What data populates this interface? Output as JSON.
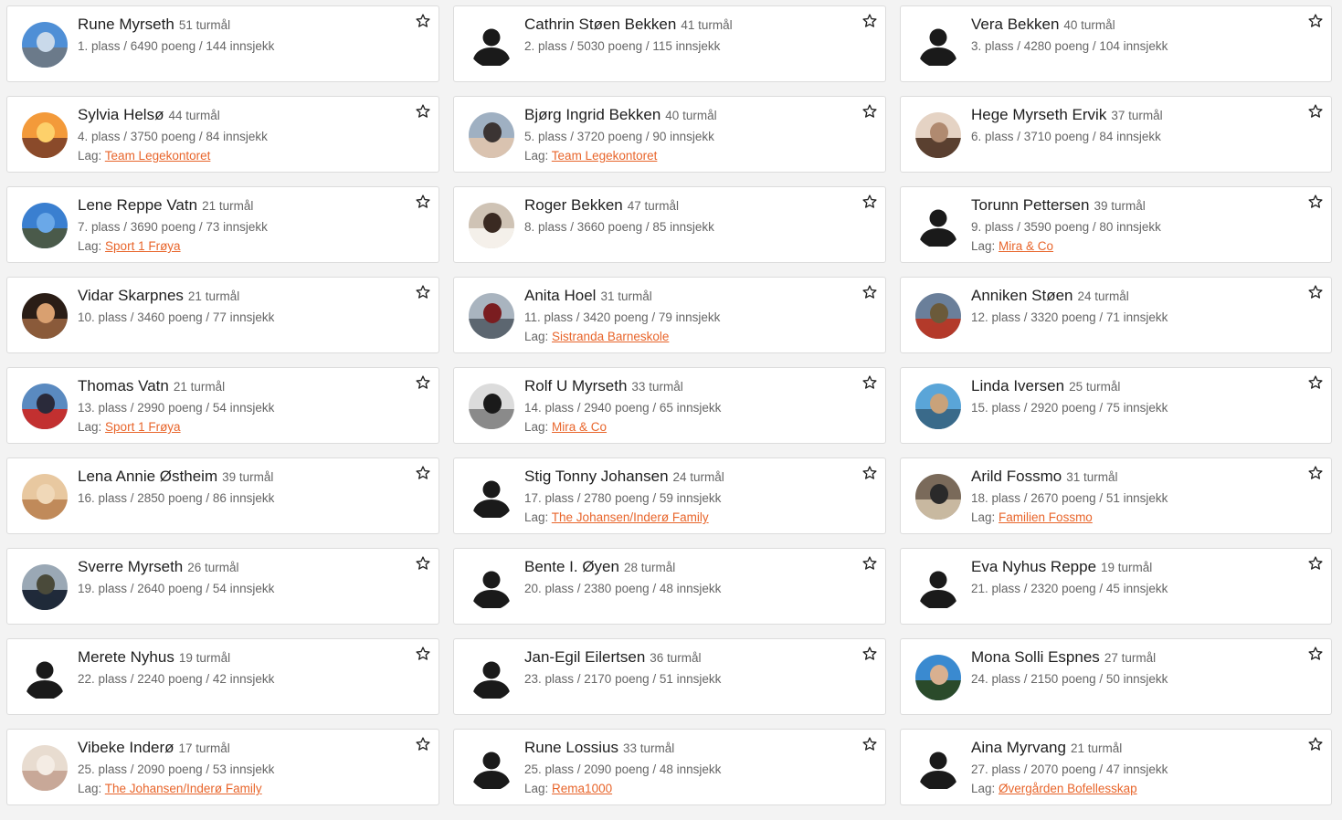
{
  "users": [
    {
      "name": "Rune Myrseth",
      "trips": "51 turmål",
      "stats": "1. plass / 6490 poeng / 144 innsjekk",
      "team": "",
      "avatar": "photo",
      "colors": [
        "#4f8fd6",
        "#c9d9ea",
        "#6b7a8a"
      ]
    },
    {
      "name": "Cathrin Støen Bekken",
      "trips": "41 turmål",
      "stats": "2. plass / 5030 poeng / 115 innsjekk",
      "team": "",
      "avatar": "default",
      "colors": []
    },
    {
      "name": "Vera Bekken",
      "trips": "40 turmål",
      "stats": "3. plass / 4280 poeng / 104 innsjekk",
      "team": "",
      "avatar": "default",
      "colors": []
    },
    {
      "name": "Sylvia Helsø",
      "trips": "44 turmål",
      "stats": "4. plass / 3750 poeng / 84 innsjekk",
      "team": "Team Legekontoret",
      "avatar": "photo",
      "colors": [
        "#f39a3a",
        "#fdd06a",
        "#8a4a2a"
      ]
    },
    {
      "name": "Bjørg Ingrid Bekken",
      "trips": "40 turmål",
      "stats": "5. plass / 3720 poeng / 90 innsjekk",
      "team": "Team Legekontoret",
      "avatar": "photo",
      "colors": [
        "#9fb0c2",
        "#3b3433",
        "#d9c3b0"
      ]
    },
    {
      "name": "Hege Myrseth Ervik",
      "trips": "37 turmål",
      "stats": "6. plass / 3710 poeng / 84 innsjekk",
      "team": "",
      "avatar": "photo",
      "colors": [
        "#e5d3c4",
        "#b08a70",
        "#5a4030"
      ]
    },
    {
      "name": "Lene Reppe Vatn",
      "trips": "21 turmål",
      "stats": "7. plass / 3690 poeng / 73 innsjekk",
      "team": "Sport 1 Frøya",
      "avatar": "photo",
      "colors": [
        "#3a7fd0",
        "#6aa8e8",
        "#4a5a4a"
      ]
    },
    {
      "name": "Roger Bekken",
      "trips": "47 turmål",
      "stats": "8. plass / 3660 poeng / 85 innsjekk",
      "team": "",
      "avatar": "photo",
      "colors": [
        "#cfc3b5",
        "#3a2a22",
        "#f4f0ea"
      ]
    },
    {
      "name": "Torunn Pettersen",
      "trips": "39 turmål",
      "stats": "9. plass / 3590 poeng / 80 innsjekk",
      "team": "Mira & Co",
      "avatar": "default",
      "colors": []
    },
    {
      "name": "Vidar Skarpnes",
      "trips": "21 turmål",
      "stats": "10. plass / 3460 poeng / 77 innsjekk",
      "team": "",
      "avatar": "photo",
      "colors": [
        "#2a1d16",
        "#d9a070",
        "#8a5a3a"
      ]
    },
    {
      "name": "Anita Hoel",
      "trips": "31 turmål",
      "stats": "11. plass / 3420 poeng / 79 innsjekk",
      "team": "Sistranda Barneskole",
      "avatar": "photo",
      "colors": [
        "#a9b4bf",
        "#7a1d20",
        "#5c6670"
      ]
    },
    {
      "name": "Anniken Støen",
      "trips": "24 turmål",
      "stats": "12. plass / 3320 poeng / 71 innsjekk",
      "team": "",
      "avatar": "photo",
      "colors": [
        "#6a7f9a",
        "#6b5a3a",
        "#b33a2a"
      ]
    },
    {
      "name": "Thomas Vatn",
      "trips": "21 turmål",
      "stats": "13. plass / 2990 poeng / 54 innsjekk",
      "team": "Sport 1 Frøya",
      "avatar": "photo",
      "colors": [
        "#5a8ac0",
        "#2a2a3a",
        "#c23030"
      ]
    },
    {
      "name": "Rolf U Myrseth",
      "trips": "33 turmål",
      "stats": "14. plass / 2940 poeng / 65 innsjekk",
      "team": "Mira & Co",
      "avatar": "photo",
      "colors": [
        "#dcdcdc",
        "#1a1a1a",
        "#8a8a8a"
      ]
    },
    {
      "name": "Linda Iversen",
      "trips": "25 turmål",
      "stats": "15. plass / 2920 poeng / 75 innsjekk",
      "team": "",
      "avatar": "photo",
      "colors": [
        "#5aa5d8",
        "#c9a27a",
        "#3a6a8a"
      ]
    },
    {
      "name": "Lena Annie Østheim",
      "trips": "39 turmål",
      "stats": "16. plass / 2850 poeng / 86 innsjekk",
      "team": "",
      "avatar": "photo",
      "colors": [
        "#e8c8a0",
        "#f0d8b8",
        "#c08a5a"
      ]
    },
    {
      "name": "Stig Tonny Johansen",
      "trips": "24 turmål",
      "stats": "17. plass / 2780 poeng / 59 innsjekk",
      "team": "The Johansen/Inderø Family",
      "avatar": "default",
      "colors": []
    },
    {
      "name": "Arild Fossmo",
      "trips": "31 turmål",
      "stats": "18. plass / 2670 poeng / 51 innsjekk",
      "team": "Familien Fossmo",
      "avatar": "photo",
      "colors": [
        "#7a6a5a",
        "#2a2a2a",
        "#c8b8a0"
      ]
    },
    {
      "name": "Sverre Myrseth",
      "trips": "26 turmål",
      "stats": "19. plass / 2640 poeng / 54 innsjekk",
      "team": "",
      "avatar": "photo",
      "colors": [
        "#9aa8b5",
        "#4a4a3a",
        "#202a3a"
      ]
    },
    {
      "name": "Bente I. Øyen",
      "trips": "28 turmål",
      "stats": "20. plass / 2380 poeng / 48 innsjekk",
      "team": "",
      "avatar": "default",
      "colors": []
    },
    {
      "name": "Eva Nyhus Reppe",
      "trips": "19 turmål",
      "stats": "21. plass / 2320 poeng / 45 innsjekk",
      "team": "",
      "avatar": "default",
      "colors": []
    },
    {
      "name": "Merete Nyhus",
      "trips": "19 turmål",
      "stats": "22. plass / 2240 poeng / 42 innsjekk",
      "team": "",
      "avatar": "default",
      "colors": []
    },
    {
      "name": "Jan-Egil Eilertsen",
      "trips": "36 turmål",
      "stats": "23. plass / 2170 poeng / 51 innsjekk",
      "team": "",
      "avatar": "default",
      "colors": []
    },
    {
      "name": "Mona Solli Espnes",
      "trips": "27 turmål",
      "stats": "24. plass / 2150 poeng / 50 innsjekk",
      "team": "",
      "avatar": "photo",
      "colors": [
        "#3a8ad0",
        "#d8b090",
        "#2a4a2a"
      ]
    },
    {
      "name": "Vibeke Inderø",
      "trips": "17 turmål",
      "stats": "25. plass / 2090 poeng / 53 innsjekk",
      "team": "The Johansen/Inderø Family",
      "avatar": "photo",
      "colors": [
        "#e8dcd0",
        "#f4ece4",
        "#c8a898"
      ]
    },
    {
      "name": "Rune Lossius",
      "trips": "33 turmål",
      "stats": "25. plass / 2090 poeng / 48 innsjekk",
      "team": "Rema1000",
      "avatar": "default",
      "colors": []
    },
    {
      "name": "Aina Myrvang",
      "trips": "21 turmål",
      "stats": "27. plass / 2070 poeng / 47 innsjekk",
      "team": "Øvergården Bofellesskap",
      "avatar": "default",
      "colors": []
    }
  ],
  "labels": {
    "team_prefix": "Lag:"
  },
  "icons": {
    "favorite": "star-outline-icon",
    "default_avatar": "user-silhouette-icon"
  },
  "colors": {
    "accent": "#e8652b",
    "silhouette": "#1a1a1a"
  }
}
